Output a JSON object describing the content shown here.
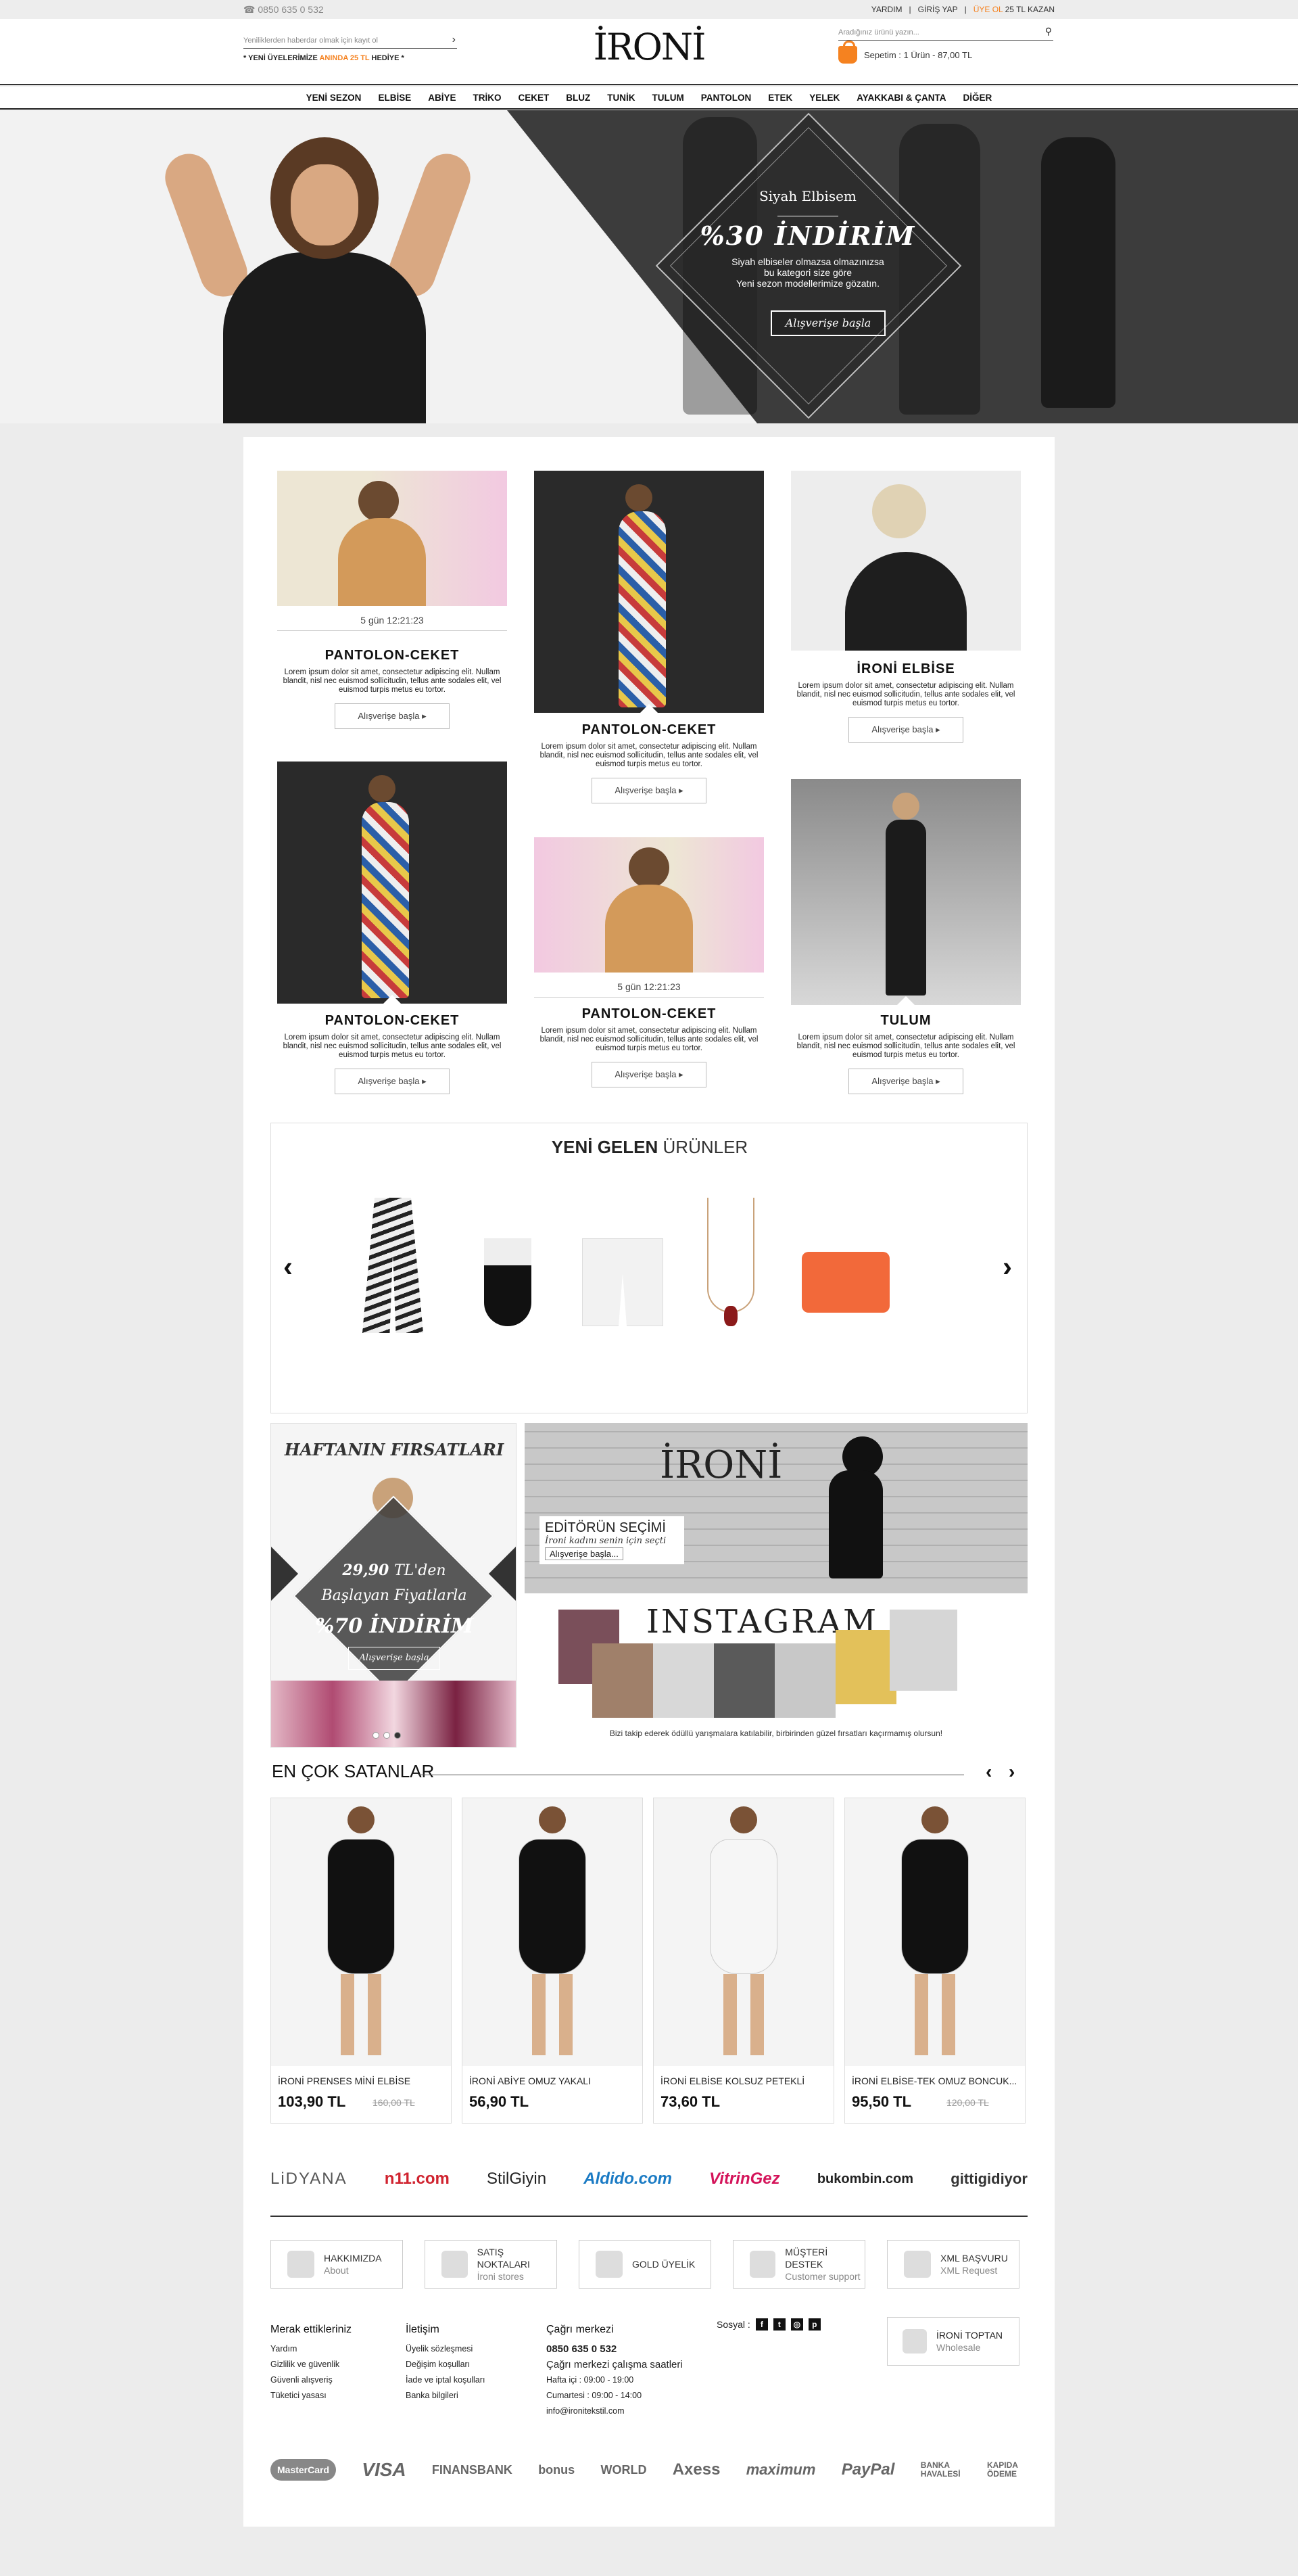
{
  "topbar": {
    "phone": "0850 635 0 532",
    "help": "YARDIM",
    "login": "GİRİŞ YAP",
    "register": "ÜYE OL",
    "earn": "25 TL KAZAN"
  },
  "header": {
    "newsletter_placeholder": "Yeniliklerden haberdar olmak için kayıt ol",
    "promo_pre": "* YENİ ÜYELERİMİZE",
    "promo_hl": "ANINDA 25 TL",
    "promo_post": "HEDİYE *",
    "logo": "İRONİ",
    "search_placeholder": "Aradığınız ürünü yazın...",
    "cart": "Sepetim : 1 Ürün - 87,00 TL"
  },
  "nav": [
    "YENİ SEZON",
    "ELBİSE",
    "ABİYE",
    "TRİKO",
    "CEKET",
    "BLUZ",
    "TUNİK",
    "TULUM",
    "PANTOLON",
    "ETEK",
    "YELEK",
    "AYAKKABI & ÇANTA",
    "DİĞER"
  ],
  "hero": {
    "title": "Siyah Elbisem",
    "discount": "%30 İNDİRİM",
    "desc1": "Siyah elbiseler olmazsa olmazınızsa",
    "desc2": "bu kategori size göre",
    "desc3": "Yeni sezon modellerimize gözatın.",
    "button": "Alışverişe başla"
  },
  "cards": [
    {
      "title": "PANTOLON-CEKET",
      "timer": "5 gün 12:21:23",
      "desc": "Lorem ipsum dolor sit amet, consectetur adipiscing elit. Nullam blandit, nisl nec euismod sollicitudin, tellus ante sodales elit, vel euismod turpis metus eu tortor.",
      "button": "Alışverişe başla"
    },
    {
      "title": "PANTOLON-CEKET",
      "desc": "Lorem ipsum dolor sit amet, consectetur adipiscing elit. Nullam blandit, nisl nec euismod sollicitudin, tellus ante sodales elit, vel euismod turpis metus eu tortor.",
      "button": "Alışverişe başla"
    },
    {
      "title": "İRONİ ELBİSE",
      "desc": "Lorem ipsum dolor sit amet, consectetur adipiscing elit. Nullam blandit, nisl nec euismod sollicitudin, tellus ante sodales elit, vel euismod turpis metus eu tortor.",
      "button": "Alışverişe başla"
    },
    {
      "title": "PANTOLON-CEKET",
      "desc": "Lorem ipsum dolor sit amet, consectetur adipiscing elit. Nullam blandit, nisl nec euismod sollicitudin, tellus ante sodales elit, vel euismod turpis metus eu tortor.",
      "button": "Alışverişe başla"
    },
    {
      "title": "PANTOLON-CEKET",
      "timer": "5 gün 12:21:23",
      "desc": "Lorem ipsum dolor sit amet, consectetur adipiscing elit. Nullam blandit, nisl nec euismod sollicitudin, tellus ante sodales elit, vel euismod turpis metus eu tortor.",
      "button": "Alışverişe başla"
    },
    {
      "title": "TULUM",
      "desc": "Lorem ipsum dolor sit amet, consectetur adipiscing elit. Nullam blandit, nisl nec euismod sollicitudin, tellus ante sodales elit, vel euismod turpis metus eu tortor.",
      "button": "Alışverişe başla"
    }
  ],
  "new_products": {
    "title_bold": "YENİ GELEN",
    "title_rest": "ÜRÜNLER",
    "prev": "‹",
    "next": "›"
  },
  "deal": {
    "title": "HAFTANIN FIRSATLARI",
    "price": "29,90",
    "price_unit": "TL'den",
    "line2": "Başlayan Fiyatlarla",
    "discount": "%70 İNDİRİM",
    "button": "Alışverişe başla"
  },
  "editor": {
    "logo": "İRONİ",
    "title": "EDİTÖRÜN SEÇİMİ",
    "subtitle": "İroni kadını senin için seçti",
    "button": "Alışverişe başla..."
  },
  "instagram": {
    "title": "INSTAGRAM",
    "caption": "Bizi takip ederek ödüllü yarışmalara katılabilir, birbirinden güzel fırsatları kaçırmamış olursun!"
  },
  "bestsellers": {
    "title": "EN ÇOK SATANLAR",
    "items": [
      {
        "name": "İRONİ PRENSES MİNİ ELBİSE",
        "price": "103,90 TL",
        "old": "160,00 TL"
      },
      {
        "name": "İRONİ ABİYE OMUZ YAKALI",
        "price": "56,90 TL",
        "old": ""
      },
      {
        "name": "İRONİ ELBİSE KOLSUZ PETEKLİ",
        "price": "73,60 TL",
        "old": ""
      },
      {
        "name": "İRONİ ELBİSE-TEK OMUZ BONCUK...",
        "price": "95,50 TL",
        "old": "120,00 TL"
      }
    ]
  },
  "brands": [
    "LiDYANA",
    "n11.com",
    "StilGiyin",
    "Aldido.com",
    "VitrinGez",
    "bukombin.com",
    "gittigidiyor"
  ],
  "info_boxes": [
    {
      "title": "HAKKIMIZDA",
      "sub": "About"
    },
    {
      "title": "SATIŞ NOKTALARI",
      "sub": "İroni stores"
    },
    {
      "title": "GOLD ÜYELİK",
      "sub": ""
    },
    {
      "title": "MÜŞTERİ DESTEK",
      "sub": "Customer support"
    },
    {
      "title": "XML BAŞVURU",
      "sub": "XML Request"
    }
  ],
  "footer": {
    "col1_title": "Merak ettikleriniz",
    "col1": [
      "Yardım",
      "Gizlilik ve güvenlik",
      "Güvenli alışveriş",
      "Tüketici yasası"
    ],
    "col2_title": "İletişim",
    "col2": [
      "Üyelik sözleşmesi",
      "Değişim koşulları",
      "İade ve iptal koşulları",
      "Banka bilgileri"
    ],
    "col3_title": "Çağrı merkezi",
    "col3_phone": "0850 635 0 532",
    "col3_hours_title": "Çağrı merkezi çalışma saatleri",
    "col3": [
      "Hafta içi : 09:00 - 19:00",
      "Cumartesi : 09:00 - 14:00",
      "info@ironitekstil.com"
    ],
    "social_label": "Sosyal :",
    "wholesale_title": "İRONİ TOPTAN",
    "wholesale_sub": "Wholesale"
  },
  "payments": [
    "MasterCard",
    "VISA",
    "FINANSBANK",
    "bonus",
    "WORLD",
    "Axess",
    "maximum",
    "PayPal",
    "BANKA HAVALESİ",
    "KAPIDA ÖDEME"
  ]
}
